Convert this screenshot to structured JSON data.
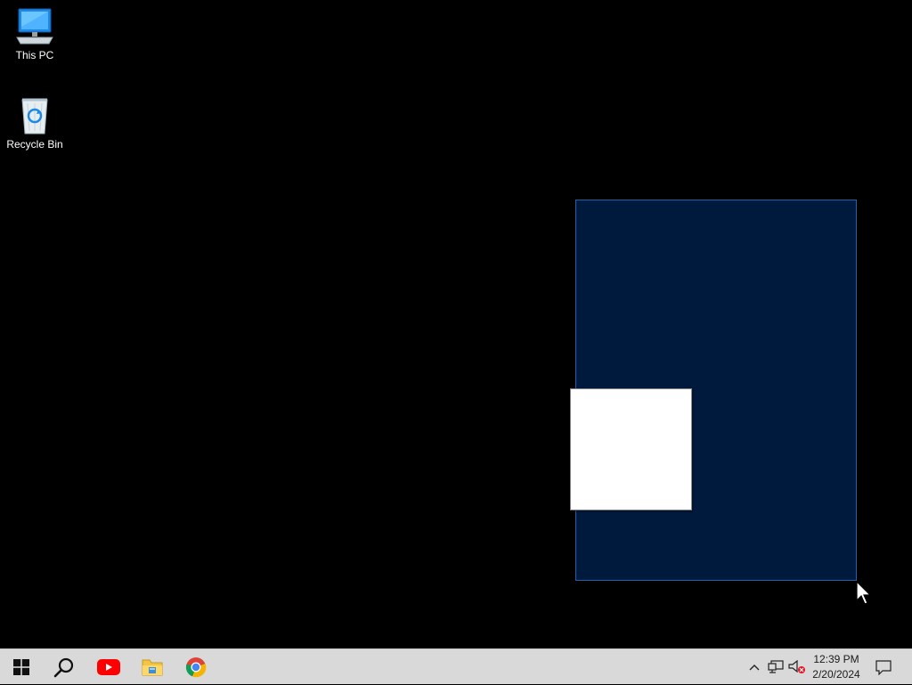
{
  "desktop": {
    "icons": [
      {
        "name": "This PC",
        "icon": "computer-icon"
      },
      {
        "name": "Recycle Bin",
        "icon": "recycle-bin-icon"
      }
    ],
    "selection_color": "#001a3d",
    "selection_border": "#2a5da8"
  },
  "taskbar": {
    "background": "#d9d9d9",
    "pinned": [
      {
        "icon": "windows-logo-icon",
        "label": "Start"
      },
      {
        "icon": "search-icon",
        "label": "Search"
      },
      {
        "icon": "youtube-icon",
        "label": "YouTube"
      },
      {
        "icon": "file-explorer-icon",
        "label": "File Explorer"
      },
      {
        "icon": "chrome-icon",
        "label": "Google Chrome"
      }
    ],
    "tray": {
      "time": "12:39 PM",
      "date": "2/20/2024",
      "icons": [
        "chevron-up-icon",
        "network-icon",
        "volume-muted-icon",
        "notification-icon"
      ]
    }
  }
}
